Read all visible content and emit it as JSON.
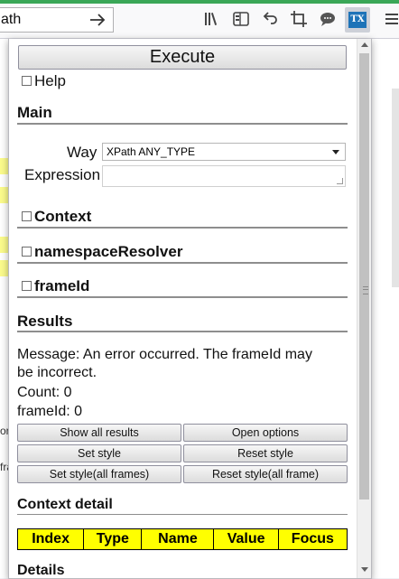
{
  "browser": {
    "url_text": "ath",
    "icons": [
      "arrow-right-icon",
      "library-icon",
      "sidebar-icon",
      "undo-icon",
      "crop-icon",
      "speech-bubble-icon",
      "tx-extension-icon",
      "hamburger-menu-icon"
    ],
    "extension_label": "TX",
    "accent_color": "#3aa757"
  },
  "background_page": {
    "frag_1": "or",
    "frag_2": "fra"
  },
  "panel": {
    "execute_label": "Execute",
    "help_label": "Help",
    "main": {
      "title": "Main",
      "way_label": "Way",
      "way_value": "XPath ANY_TYPE",
      "expression_label": "Expression",
      "expression_value": ""
    },
    "context_label": "Context",
    "namespace_label": "namespaceResolver",
    "frameid_label": "frameId",
    "results": {
      "title": "Results",
      "message_line1": "Message: An error occurred. The frameId may",
      "message_line2": "be incorrect.",
      "count": "Count: 0",
      "frameid": "frameId: 0",
      "buttons": {
        "show_all": "Show all results",
        "open_options": "Open options",
        "set_style": "Set style",
        "reset_style": "Reset style",
        "set_style_all": "Set style(all frames)",
        "reset_style_all": "Reset style(all frame)"
      }
    },
    "context_detail": {
      "title": "Context detail",
      "columns": [
        "Index",
        "Type",
        "Name",
        "Value",
        "Focus"
      ],
      "header_color": "#ffff00"
    },
    "details_title": "Details"
  }
}
